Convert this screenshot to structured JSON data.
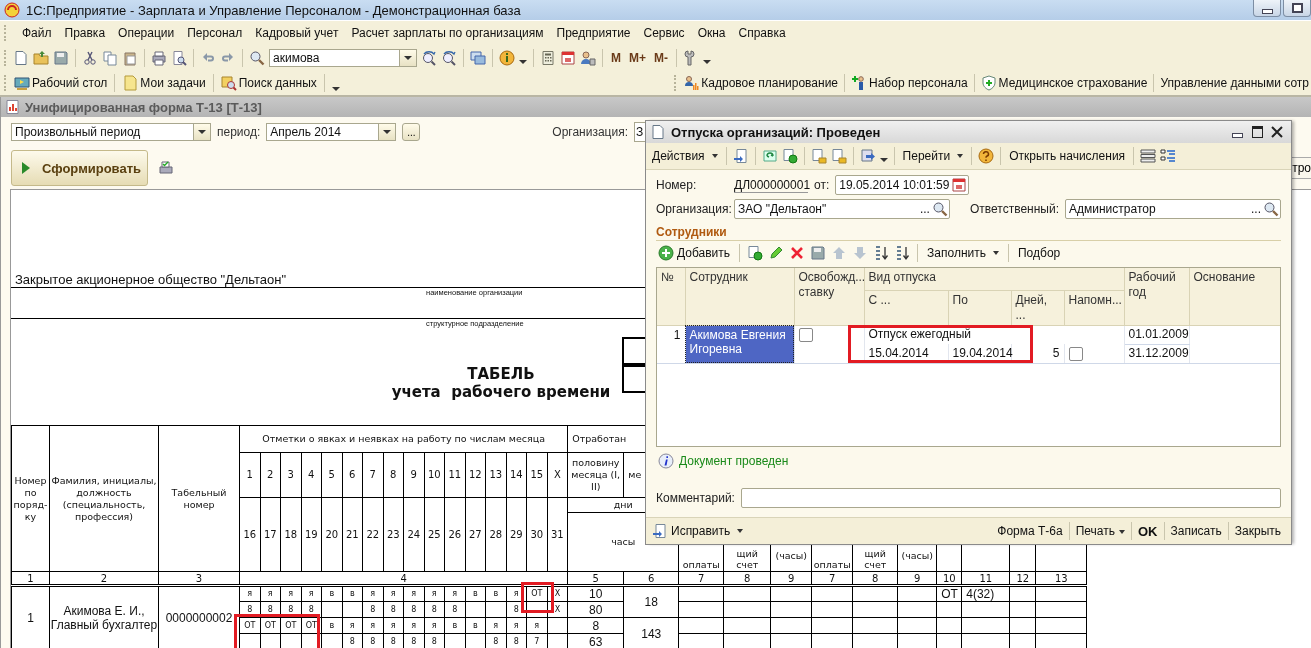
{
  "window": {
    "title": "1С:Предприятие - Зарплата и Управление Персоналом - Демонстрационная база"
  },
  "menu": [
    "Файл",
    "Правка",
    "Операции",
    "Персонал",
    "Кадровый учет",
    "Расчет зарплаты по организациям",
    "Предприятие",
    "Сервис",
    "Окна",
    "Справка"
  ],
  "search": {
    "value": "акимова"
  },
  "memory_buttons": [
    "M",
    "M+",
    "M-"
  ],
  "panels_left": [
    "Рабочий стол",
    "Мои задачи",
    "Поиск данных"
  ],
  "panels_right": [
    "Кадровое планирование",
    "Набор персонала",
    "Медицинское страхование",
    "Управление данными сотр"
  ],
  "form": {
    "title": "Унифицированная форма Т-13 [Т-13]",
    "period_type": "Произвольный период",
    "period_label": "период:",
    "period": "Апрель 2014",
    "ellipsis": "...",
    "org_label": "Организация:",
    "org_value": "З",
    "generate": "Сформировать",
    "cut_button": "тро"
  },
  "report": {
    "org_name": "Закрытое акционерное общество \"Дельтаон\"",
    "org_caption": "наименование организации",
    "dept_caption": "структурное подразделение",
    "title": "ТАБЕЛЬ",
    "subtitle": "учета  рабочего времени",
    "h_num": "Номер по поряд-ку",
    "h_name": "Фамилия, инициалы, должность (специальность, профессия)",
    "h_tab": "Табельный номер",
    "h_marks": "Отметки о явках и неявках на работу по числам месяца",
    "h_worked": "Отработан",
    "h_half": "половину месяца (I, II)",
    "h_month": "ме",
    "h_days": "дни",
    "h_hours": "часы",
    "days_first": [
      "1",
      "2",
      "3",
      "4",
      "5",
      "6",
      "7",
      "8",
      "9",
      "10",
      "11",
      "12",
      "13",
      "14",
      "15",
      "X"
    ],
    "days_second": [
      "16",
      "17",
      "18",
      "19",
      "20",
      "21",
      "22",
      "23",
      "24",
      "25",
      "26",
      "27",
      "28",
      "29",
      "30",
      "31"
    ],
    "lower_headers": [
      "оплаты",
      "щий счет",
      "(часы)",
      "оплаты",
      "щий счет",
      "(часы)"
    ],
    "col_numbers": [
      "1",
      "2",
      "3",
      "4",
      "5",
      "6",
      "7",
      "8",
      "9",
      "7",
      "8",
      "9",
      "10",
      "11",
      "12",
      "13"
    ],
    "employee": {
      "number": "1",
      "name": "Акимова Е. И., Главный бухгалтер",
      "tab_number": "0000000002",
      "col6": [
        "18",
        "143"
      ],
      "lines": [
        {
          "marks": {
            "1": "я",
            "2": "я",
            "3": "я",
            "4": "я",
            "5": "в",
            "6": "в",
            "7": "я",
            "8": "я",
            "9": "я",
            "10": "я",
            "11": "я",
            "12": "в",
            "13": "в",
            "14": "я",
            "15": "ОТ",
            "16": "X"
          },
          "col5": "10",
          "c10": "ОТ",
          "c11": "4(32)"
        },
        {
          "marks": {
            "1": "8",
            "2": "8",
            "3": "8",
            "4": "8",
            "7": "8",
            "8": "8",
            "9": "8",
            "10": "8",
            "11": "8",
            "14": "8",
            "16": "X"
          },
          "col5": "80"
        },
        {
          "marks": {
            "1": "ОТ",
            "2": "ОТ",
            "3": "ОТ",
            "4": "ОТ",
            "5": "в",
            "6": "я",
            "7": "я",
            "8": "я",
            "9": "я",
            "10": "я",
            "11": "в",
            "12": "в",
            "13": "я",
            "14": "я",
            "15": "я"
          },
          "col5": "8"
        },
        {
          "marks": {
            "6": "8",
            "7": "8",
            "8": "8",
            "9": "8",
            "10": "8",
            "13": "8",
            "14": "8",
            "15": "7"
          },
          "col5": "63"
        }
      ]
    }
  },
  "dialog": {
    "title": "Отпуска организаций: Проведен",
    "actions": "Действия",
    "goto": "Перейти",
    "open_accruals": "Открыть начисления",
    "number_label": "Номер:",
    "number": "ДЛ000000001",
    "date_label": "от:",
    "date": "19.05.2014 10:01:59",
    "org_label": "Организация:",
    "org": "ЗАО \"Дельтаон\"",
    "org_ellipsis": "...",
    "resp_label": "Ответственный:",
    "resp": "Администратор",
    "resp_ellipsis": "...",
    "section": "Сотрудники",
    "add": "Добавить",
    "fill": "Заполнить",
    "pick": "Подбор",
    "columns": {
      "no": "№",
      "employee": "Сотрудник",
      "release": "Освобожд... ставку",
      "kind": "Вид отпуска",
      "from": "С ...",
      "to": "По",
      "days": "Дней, ...",
      "remind": "Напомн...",
      "year": "Рабочий год",
      "basis": "Основание"
    },
    "rows": [
      {
        "no": "1",
        "employee": "Акимова Евгения Игоревна",
        "selected": true,
        "release": false,
        "kind": "Отпуск ежегодный",
        "from": "15.04.2014",
        "to": "19.04.2014",
        "days": "5",
        "remind": false,
        "year_from": "01.01.2009",
        "year_to": "31.12.2009"
      }
    ],
    "status": "Документ проведен",
    "comment_label": "Комментарий:",
    "fix": "Исправить",
    "footer": [
      {
        "label": "Форма Т-6а",
        "kind": "plain"
      },
      {
        "label": "Печать",
        "kind": "menu"
      },
      {
        "label": "OK",
        "kind": "default"
      },
      {
        "label": "Записать",
        "kind": "plain"
      },
      {
        "label": "Закрыть",
        "kind": "plain"
      }
    ]
  }
}
